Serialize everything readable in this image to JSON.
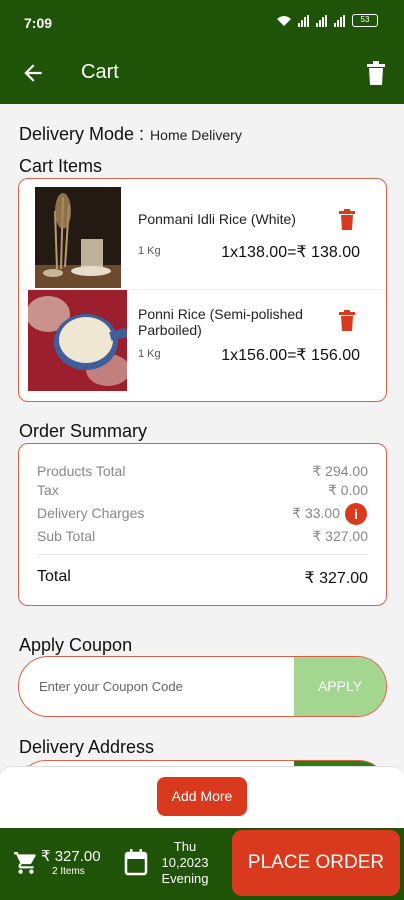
{
  "status_bar": {
    "time": "7:09",
    "battery": "53"
  },
  "header": {
    "title": "Cart"
  },
  "delivery_mode": {
    "label": "Delivery Mode :",
    "value": "Home Delivery"
  },
  "cart": {
    "heading": "Cart Items",
    "items": [
      {
        "name": "Ponmani Idli Rice (White)",
        "qty": "1 Kg",
        "price": "1x138.00=₹ 138.00"
      },
      {
        "name": "Ponni Rice (Semi-polished Parboiled)",
        "qty": "1 Kg",
        "price": "1x156.00=₹ 156.00"
      }
    ]
  },
  "order_summary": {
    "heading": "Order Summary",
    "rows": [
      {
        "label": "Products Total",
        "value": "₹ 294.00"
      },
      {
        "label": "Tax",
        "value": "₹ 0.00"
      },
      {
        "label": "Delivery Charges",
        "value": "₹ 33.00"
      },
      {
        "label": "Sub Total",
        "value": "₹ 327.00"
      }
    ],
    "info_glyph": "i",
    "total_label": "Total",
    "total_value": "₹ 327.00"
  },
  "coupon": {
    "heading": "Apply Coupon",
    "placeholder": "Enter your Coupon Code",
    "button": "APPLY"
  },
  "address": {
    "heading": "Delivery Address"
  },
  "add_more": {
    "label": "Add More"
  },
  "bottom_bar": {
    "amount": "₹ 327.00",
    "items": "2 Items",
    "day": "Thu",
    "date": "10,2023",
    "slot": "Evening",
    "place_order": "PLACE ORDER"
  },
  "colors": {
    "primary_green": "#1f5308",
    "accent_red": "#d93a1d",
    "border_red": "#d9604a",
    "apply_green": "#a3d790"
  }
}
